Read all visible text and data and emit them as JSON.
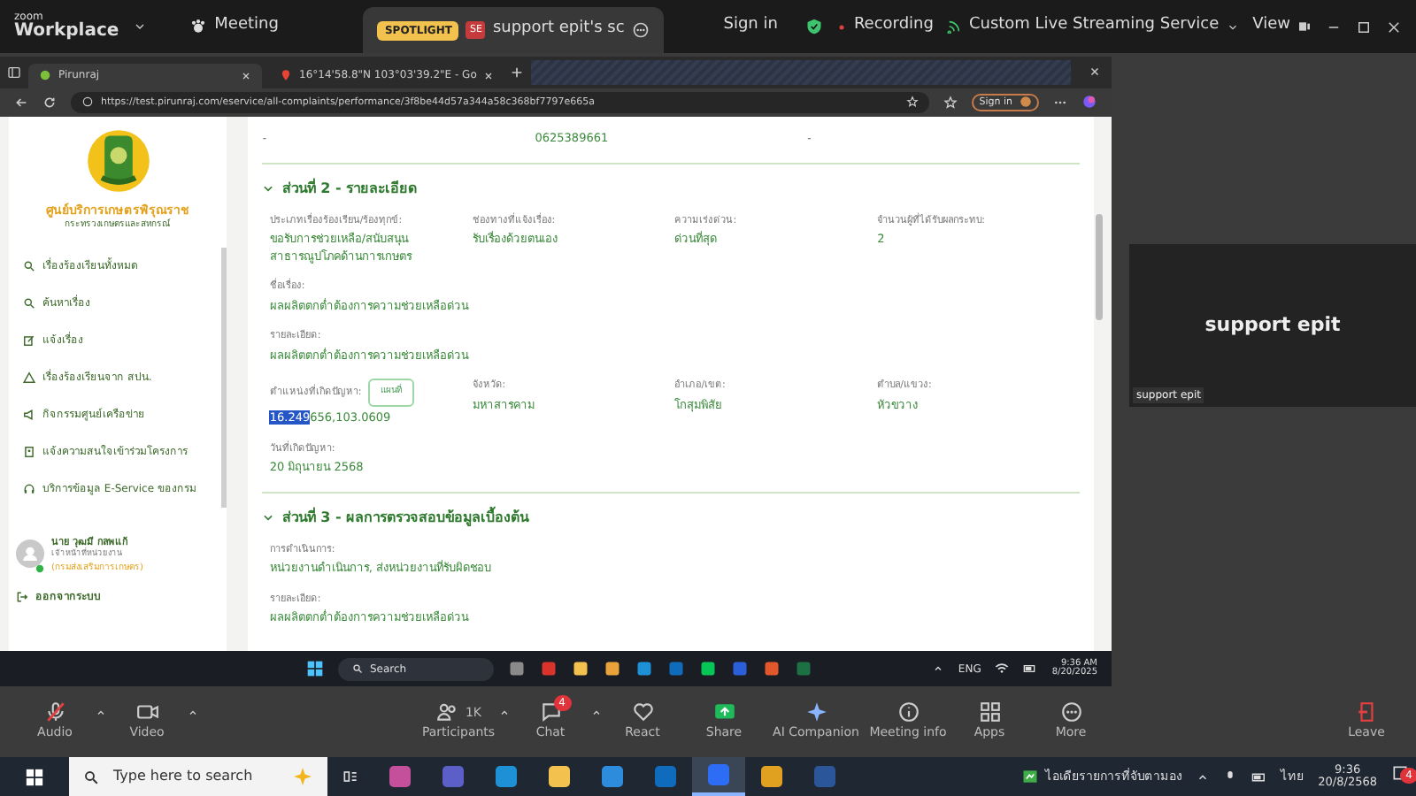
{
  "zoom_bar": {
    "brand_top": "zoom",
    "brand": "Workplace",
    "meeting": "Meeting",
    "spotlight": "SPOTLIGHT",
    "share_avatar": "SE",
    "share_title": "support epit's sc",
    "sign_in": "Sign in",
    "recording": "Recording",
    "streaming": "Custom Live Streaming Service",
    "view": "View"
  },
  "browser": {
    "tabs": [
      {
        "label": "Pirunraj",
        "selected": true
      },
      {
        "label": "16°14'58.8\"N 103°03'39.2\"E - Go",
        "selected": false
      }
    ],
    "url": "https://test.pirunraj.com/eservice/all-complaints/performance/3f8be44d57a344a58c368bf7797e665a",
    "sign_in": "Sign in"
  },
  "sidebar": {
    "title": "ศูนย์บริการเกษตรพิรุณราช",
    "subtitle": "กระทรวงเกษตรและสหกรณ์",
    "items": [
      {
        "label": "เรื่องร้องเรียนทั้งหมด",
        "kind": "search"
      },
      {
        "label": "ค้นหาเรื่อง",
        "kind": "search"
      },
      {
        "label": "แจ้งเรื่อง",
        "kind": "edit"
      },
      {
        "label": "เรื่องร้องเรียนจาก สปน.",
        "kind": "warning"
      },
      {
        "label": "กิจกรรมศูนย์เครือข่าย",
        "kind": "megaphone"
      },
      {
        "label": "แจ้งความสนใจเข้าร่วมโครงการ",
        "kind": "document"
      },
      {
        "label": "บริการข้อมูล E-Service ของกรม",
        "kind": "headset"
      }
    ],
    "user": {
      "name": "นาย วุฒมี กลพแก้",
      "role": "เจ้าหน้าที่หน่วยงาน",
      "org": "(กรมส่งเสริมการเกษตร)",
      "online": true
    },
    "logout": "ออกจากระบบ"
  },
  "content": {
    "top_row": [
      "-",
      "0625389661",
      "-"
    ],
    "sections": [
      {
        "title": "ส่วนที่ 2 - รายละเอียด",
        "expanded": true,
        "rows": [
          [
            {
              "label": "ประเภทเรื่องร้องเรียน/ร้องทุกข์:",
              "value": "ขอรับการช่วยเหลือ/สนับสนุน สาธารณูปโภคด้านการเกษตร",
              "kind": "text"
            },
            {
              "label": "ช่องทางที่แจ้งเรื่อง:",
              "value": "รับเรื่องด้วยตนเอง",
              "kind": "text"
            },
            {
              "label": "ความเร่งด่วน:",
              "value": "ด่วนที่สุด",
              "kind": "text"
            },
            {
              "label": "จำนวนผู้ที่ได้รับผลกระทบ:",
              "value": "2",
              "kind": "text"
            }
          ],
          [
            {
              "label": "ชื่อเรื่อง:",
              "value": "ผลผลิตตกต่ำต้องการความช่วยเหลือด่วน",
              "kind": "text"
            }
          ],
          [
            {
              "label": "รายละเอียด:",
              "value": "ผลผลิตตกต่ำต้องการความช่วยเหลือด่วน",
              "kind": "text"
            }
          ],
          [
            {
              "label": "ตำแหน่งที่เกิดปัญหา:",
              "kind": "location",
              "button": "แผนที่",
              "value_parts": [
                {
                  "text": "16.249",
                  "selected": true
                },
                {
                  "text": "656,103.0609",
                  "selected": false
                }
              ]
            },
            {
              "label": "จังหวัด:",
              "value": "มหาสารคาม",
              "kind": "text"
            },
            {
              "label": "อำเภอ/เขต:",
              "value": "โกสุมพิสัย",
              "kind": "text"
            },
            {
              "label": "ตำบล/แขวง:",
              "value": "หัวขวาง",
              "kind": "text"
            }
          ],
          [
            {
              "label": "วันที่เกิดปัญหา:",
              "value": "20 มิถุนายน 2568",
              "kind": "text"
            }
          ]
        ]
      },
      {
        "title": "ส่วนที่ 3 - ผลการตรวจสอบข้อมูลเบื้องต้น",
        "expanded": true,
        "rows": [
          [
            {
              "label": "การดำเนินการ:",
              "value": "หน่วยงานดำเนินการ, ส่งหน่วยงานที่รับผิดชอบ",
              "kind": "text"
            }
          ],
          [
            {
              "label": "รายละเอียด:",
              "value": "ผลผลิตตกต่ำต้องการความช่วยเหลือด่วน",
              "kind": "text"
            }
          ]
        ]
      }
    ]
  },
  "remote_taskbar": {
    "search": "Search",
    "apps": [
      {
        "color": "#8a8a8a"
      },
      {
        "color": "#d9342b"
      },
      {
        "color": "#f2c14e"
      },
      {
        "color": "#e8a33a"
      },
      {
        "color": "#1e90d6"
      },
      {
        "color": "#0f6cbd"
      },
      {
        "color": "#06c755"
      },
      {
        "color": "#2b5fd9"
      },
      {
        "color": "#e2562c"
      },
      {
        "color": "#1d7044"
      }
    ],
    "lang": "ENG",
    "time": "9:36 AM",
    "date": "8/20/2025"
  },
  "video_tile": {
    "name": "support epit",
    "label": "support epit"
  },
  "toolbar": {
    "items": [
      {
        "label": "Audio",
        "kind": "audio",
        "muted": true
      },
      {
        "label": "Video",
        "kind": "video"
      },
      {
        "label": "Participants",
        "kind": "participants",
        "count": "1K"
      },
      {
        "label": "Chat",
        "kind": "chat",
        "badge": "4"
      },
      {
        "label": "React",
        "kind": "react"
      },
      {
        "label": "Share",
        "kind": "share"
      },
      {
        "label": "AI Companion",
        "kind": "ai"
      },
      {
        "label": "Meeting info",
        "kind": "info"
      },
      {
        "label": "Apps",
        "kind": "apps"
      },
      {
        "label": "More",
        "kind": "more"
      }
    ],
    "leave": "Leave"
  },
  "taskbar": {
    "search": "Type here to search",
    "apps": [
      {
        "color": "#c4509c",
        "selected": false
      },
      {
        "color": "#5b5fc7",
        "selected": false
      },
      {
        "color": "#1e90d6",
        "selected": false
      },
      {
        "color": "#f2c14e",
        "selected": false
      },
      {
        "color": "#2d8cdb",
        "selected": false
      },
      {
        "color": "#0f6cbd",
        "selected": false
      },
      {
        "color": "#2d6cf5",
        "selected": true
      },
      {
        "color": "#e0a020",
        "selected": false
      },
      {
        "color": "#2b579a",
        "selected": false
      }
    ],
    "news": "ไอเดียรายการที่จับตามอง",
    "lang": "ไทย",
    "time": "9:36",
    "date": "20/8/2568",
    "badge": "4"
  }
}
